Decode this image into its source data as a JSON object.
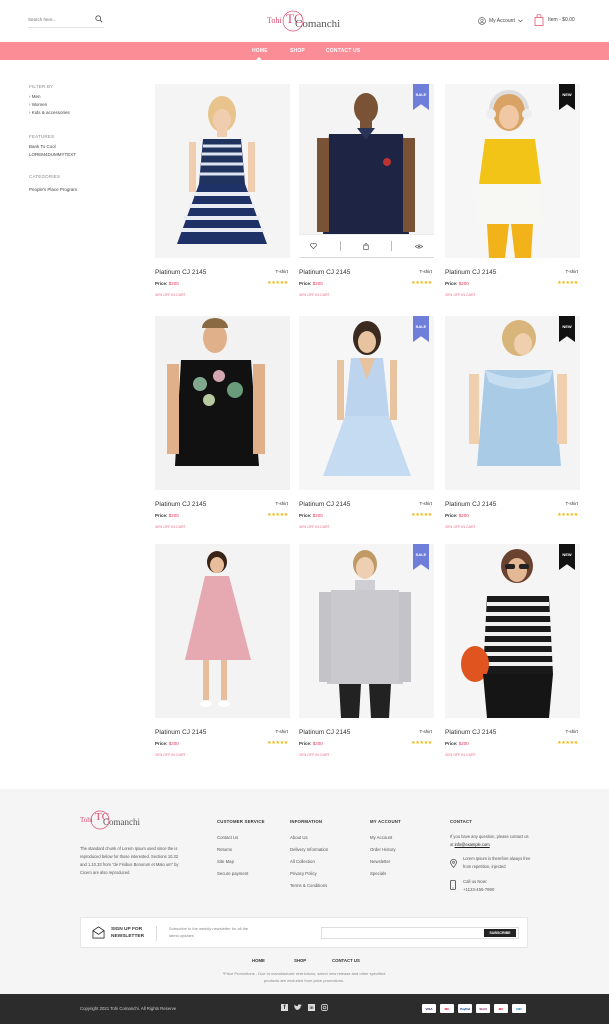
{
  "header": {
    "search_placeholder": "Search here...",
    "logo_line1": "Tohi",
    "logo_mono": "TC",
    "logo_line2": "Comanchi",
    "account_label": "My Account",
    "cart_label": "Item - $0.00"
  },
  "nav": {
    "items": [
      "HOME",
      "SHOP",
      "CONTACT US"
    ],
    "active": "HOME"
  },
  "sidebar": {
    "filter_heading": "FILTER BY",
    "filters": [
      "Men",
      "Women",
      "Kids & accessories"
    ],
    "features_heading": "FEATURES",
    "features": [
      "Bank To Cool",
      "LOREM4DUMMYTEXT"
    ],
    "categories_heading": "CATEGORIES",
    "categories": [
      "People's Place Program"
    ]
  },
  "products": [
    {
      "name": "Platinum CJ 2145",
      "tag": "T-shirt",
      "price_label": "Price:",
      "price": "$200",
      "stars": "★★★★★",
      "offer": "30% OFF IN CART",
      "badge": "",
      "hover": false,
      "art": "dress-stripes"
    },
    {
      "name": "Platinum CJ 2145",
      "tag": "T-shirt",
      "price_label": "Price:",
      "price": "$200",
      "stars": "★★★★★",
      "offer": "30% OFF IN CART",
      "badge": "SALE",
      "hover": true,
      "art": "polo-navy"
    },
    {
      "name": "Platinum CJ 2145",
      "tag": "T-shirt",
      "price_label": "Price:",
      "price": "$200",
      "stars": "★★★★★",
      "offer": "30% OFF IN CART",
      "badge": "NEW",
      "hover": false,
      "art": "kid-yellow"
    },
    {
      "name": "Platinum CJ 2145",
      "tag": "T-shirt",
      "price_label": "Price:",
      "price": "$200",
      "stars": "★★★★★",
      "offer": "30% OFF IN CART",
      "badge": "",
      "hover": false,
      "art": "tee-floral"
    },
    {
      "name": "Platinum CJ 2145",
      "tag": "T-shirt",
      "price_label": "Price:",
      "price": "$200",
      "stars": "★★★★★",
      "offer": "30% OFF IN CART",
      "badge": "SALE",
      "hover": false,
      "art": "dress-blue"
    },
    {
      "name": "Platinum CJ 2145",
      "tag": "T-shirt",
      "price_label": "Price:",
      "price": "$200",
      "stars": "★★★★★",
      "offer": "30% OFF IN CART",
      "badge": "NEW",
      "hover": false,
      "art": "kid-blue"
    },
    {
      "name": "Platinum CJ 2145",
      "tag": "T-shirt",
      "price_label": "Price:",
      "price": "$200",
      "stars": "★★★★★",
      "offer": "30% OFF IN CART",
      "badge": "",
      "hover": false,
      "art": "kid-pink"
    },
    {
      "name": "Platinum CJ 2145",
      "tag": "T-shirt",
      "price_label": "Price:",
      "price": "$200",
      "stars": "★★★★★",
      "offer": "30% OFF IN CART",
      "badge": "SALE",
      "hover": false,
      "art": "sweater-grey"
    },
    {
      "name": "Platinum CJ 2145",
      "tag": "T-shirt",
      "price_label": "Price:",
      "price": "$200",
      "stars": "★★★★★",
      "offer": "30% OFF IN CART",
      "badge": "NEW",
      "hover": false,
      "art": "woman-stripes"
    }
  ],
  "footer": {
    "about": "The standard chunk of Lorem Ipsum used since the is reproduced below for those interested. Sections 10.32 and 1.10.33 from \"de Finibus Bonorum et Malo um\" by Cicero are also reproduced",
    "customer_service": {
      "heading": "CUSTOMER SERVICE",
      "links": [
        "Contact Us",
        "Returns",
        "Site Map",
        "Secure payment"
      ]
    },
    "information": {
      "heading": "INFORMATION",
      "links": [
        "About Us",
        "Delivery Information",
        "All Collection",
        "Privacy Policy",
        "Terms & Conditions"
      ]
    },
    "my_account": {
      "heading": "MY ACCOUNT",
      "links": [
        "My Account",
        "Order History",
        "Newsletter",
        "Specials"
      ]
    },
    "contact": {
      "heading": "CONTACT",
      "intro": "If you have any question, please contact us at",
      "email": "info@example.com",
      "address": "Lorem Ipsum is therefore always free from repetition, injected",
      "call_label": "Call us Now:",
      "phone": "+1123-456-7890"
    },
    "newsletter": {
      "title": "SIGN UP FOR NEWSLETTER",
      "text": "Subscribe to the weekly newsletter for all the latest updates",
      "input_placeholder": "",
      "button": "SUBSCRIBE"
    },
    "bottom_links": [
      "HOME",
      "SHOP",
      "CONTACT US"
    ],
    "notice": "*Price Promotions - Due to manufacturer restrictions, select new release and other specified products are excluded from price promotions.",
    "copyright": "Copyright 2021 Tohi Comanchi. All Rights Reserve",
    "payments": [
      "VISA",
      "MC",
      "PayPal",
      "Skrill",
      "MC",
      "DIN"
    ]
  },
  "colors": {
    "accent": "#fb8d97",
    "sale": "#6f7fd9",
    "new": "#111111",
    "price": "#e03b5d",
    "stars": "#f5b400"
  }
}
